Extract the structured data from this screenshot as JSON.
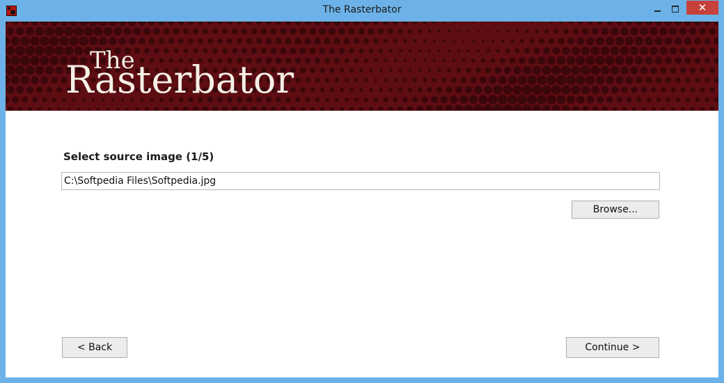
{
  "window": {
    "title": "The Rasterbator",
    "close_glyph": "✕"
  },
  "banner": {
    "logo_line1": "The",
    "logo_line2": "Rasterbator",
    "colors": {
      "base": "#5e0d12",
      "dots": "#3a070b"
    }
  },
  "wizard": {
    "step_label": "Select source image (1/5)",
    "source_path": "C:\\Softpedia Files\\Softpedia.jpg",
    "browse_label": "Browse...",
    "back_label": "< Back",
    "continue_label": "Continue >"
  },
  "icons": {
    "app": "rasterbator-app-icon",
    "minimize": "minimize-icon",
    "maximize": "maximize-icon",
    "close": "close-icon"
  }
}
